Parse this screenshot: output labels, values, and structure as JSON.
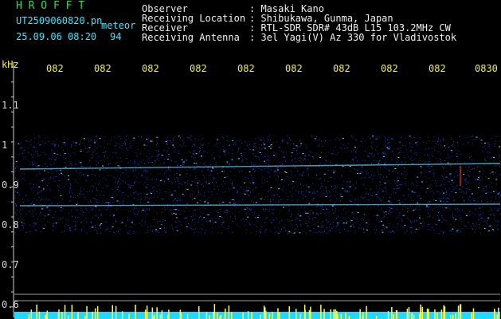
{
  "header": {
    "app_title": "H R O F F T",
    "file_name": "UT2509060820.pn",
    "mode_label": "meteor",
    "date_time": "25.09.06 08:20",
    "count": "94",
    "fields": [
      {
        "label": "Observer",
        "value": ": Masaki Kano"
      },
      {
        "label": "Receiving Location",
        "value": ": Shibukawa, Gunma, Japan"
      },
      {
        "label": "Receiver",
        "value": ": RTL-SDR SDR# 43dB L15 103.2MHz CW"
      },
      {
        "label": "Receiving Antenna",
        "value": ": 3el Yagi(V) Az 330 for Vladivostok"
      }
    ]
  },
  "spectrogram": {
    "unit_label": "kHz",
    "y_ticks": [
      "1.1",
      "1",
      "0.9",
      "0.8",
      "0.7",
      "0.6"
    ],
    "time_ticks": [
      "082",
      "082",
      "082",
      "082",
      "082",
      "082",
      "082",
      "082",
      "082",
      "0830"
    ],
    "colors": {
      "background": "#000000",
      "noise": "#2a4cff",
      "line": "#66dcff",
      "bottom_band": "#22d8ff",
      "bottom_spikes": "#ffff38"
    }
  }
}
